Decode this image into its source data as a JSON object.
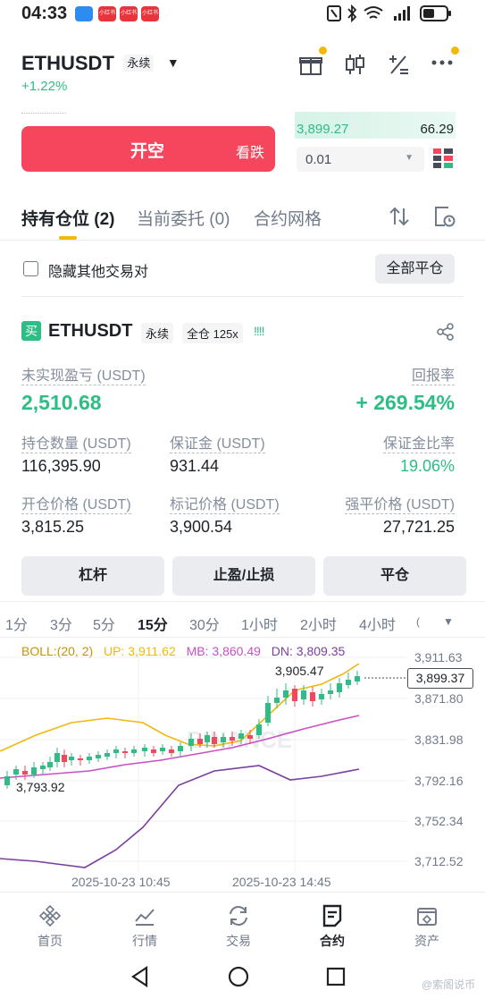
{
  "status": {
    "time": "04:33",
    "notif_label": "小红书"
  },
  "header": {
    "symbol": "ETHUSDT",
    "contract_type": "永续",
    "change": "+1.22%"
  },
  "trade": {
    "open_short_label": "开空",
    "open_short_sub": "看跌",
    "orderbook_price": "3,899.27",
    "orderbook_qty": "66.29",
    "depth_select": "0.01"
  },
  "tabs": [
    {
      "label": "持有仓位 (2)"
    },
    {
      "label": "当前委托 (0)"
    },
    {
      "label": "合约网格"
    }
  ],
  "filters": {
    "hide_others_label": "隐藏其他交易对",
    "close_all_label": "全部平仓"
  },
  "position": {
    "side_badge": "买",
    "symbol": "ETHUSDT",
    "contract_type": "永续",
    "margin_mode": "全仓 125x",
    "bars_glyph": "!!!!",
    "pnl_label": "未实现盈亏 (USDT)",
    "pnl_value": "2,510.68",
    "roe_label": "回报率",
    "roe_value": "+ 269.54%",
    "size_label": "持仓数量 (USDT)",
    "size_value": "116,395.90",
    "margin_label": "保证金 (USDT)",
    "margin_value": "931.44",
    "margin_ratio_label": "保证金比率",
    "margin_ratio_value": "19.06%",
    "entry_label": "开仓价格 (USDT)",
    "entry_value": "3,815.25",
    "mark_label": "标记价格 (USDT)",
    "mark_value": "3,900.54",
    "liq_label": "强平价格 (USDT)",
    "liq_value": "27,721.25",
    "btn_leverage": "杠杆",
    "btn_tpsl": "止盈/止损",
    "btn_close": "平仓"
  },
  "timeframes": [
    "1分",
    "3分",
    "5分",
    "15分",
    "30分",
    "1小时",
    "2小时",
    "4小时"
  ],
  "timeframe_active": "15分",
  "chart": {
    "boll_label": "BOLL:(20, 2)",
    "up_label": "UP: 3,911.62",
    "mb_label": "MB: 3,860.49",
    "dn_label": "DN: 3,809.35",
    "y_ticks": [
      "3,911.63",
      "3,871.80",
      "3,831.98",
      "3,792.16",
      "3,752.34",
      "3,712.52"
    ],
    "high_marker": "3,905.47",
    "low_marker": "3,793.92",
    "last_price": "3,899.37",
    "x_ticks": [
      "2025-10-23 10:45",
      "2025-10-23 14:45"
    ],
    "watermark": "BINANCE",
    "colors": {
      "up": "#2ebd85",
      "down": "#f6465d",
      "boll_up": "#f0b90b",
      "boll_mb": "#c94fc4",
      "boll_dn": "#7b3fa0"
    }
  },
  "nav": [
    {
      "label": "首页",
      "icon": "home-icon"
    },
    {
      "label": "行情",
      "icon": "markets-icon"
    },
    {
      "label": "交易",
      "icon": "trade-icon"
    },
    {
      "label": "合约",
      "icon": "futures-icon"
    },
    {
      "label": "资产",
      "icon": "wallet-icon"
    }
  ],
  "watermark_corner": "@索阁说币"
}
